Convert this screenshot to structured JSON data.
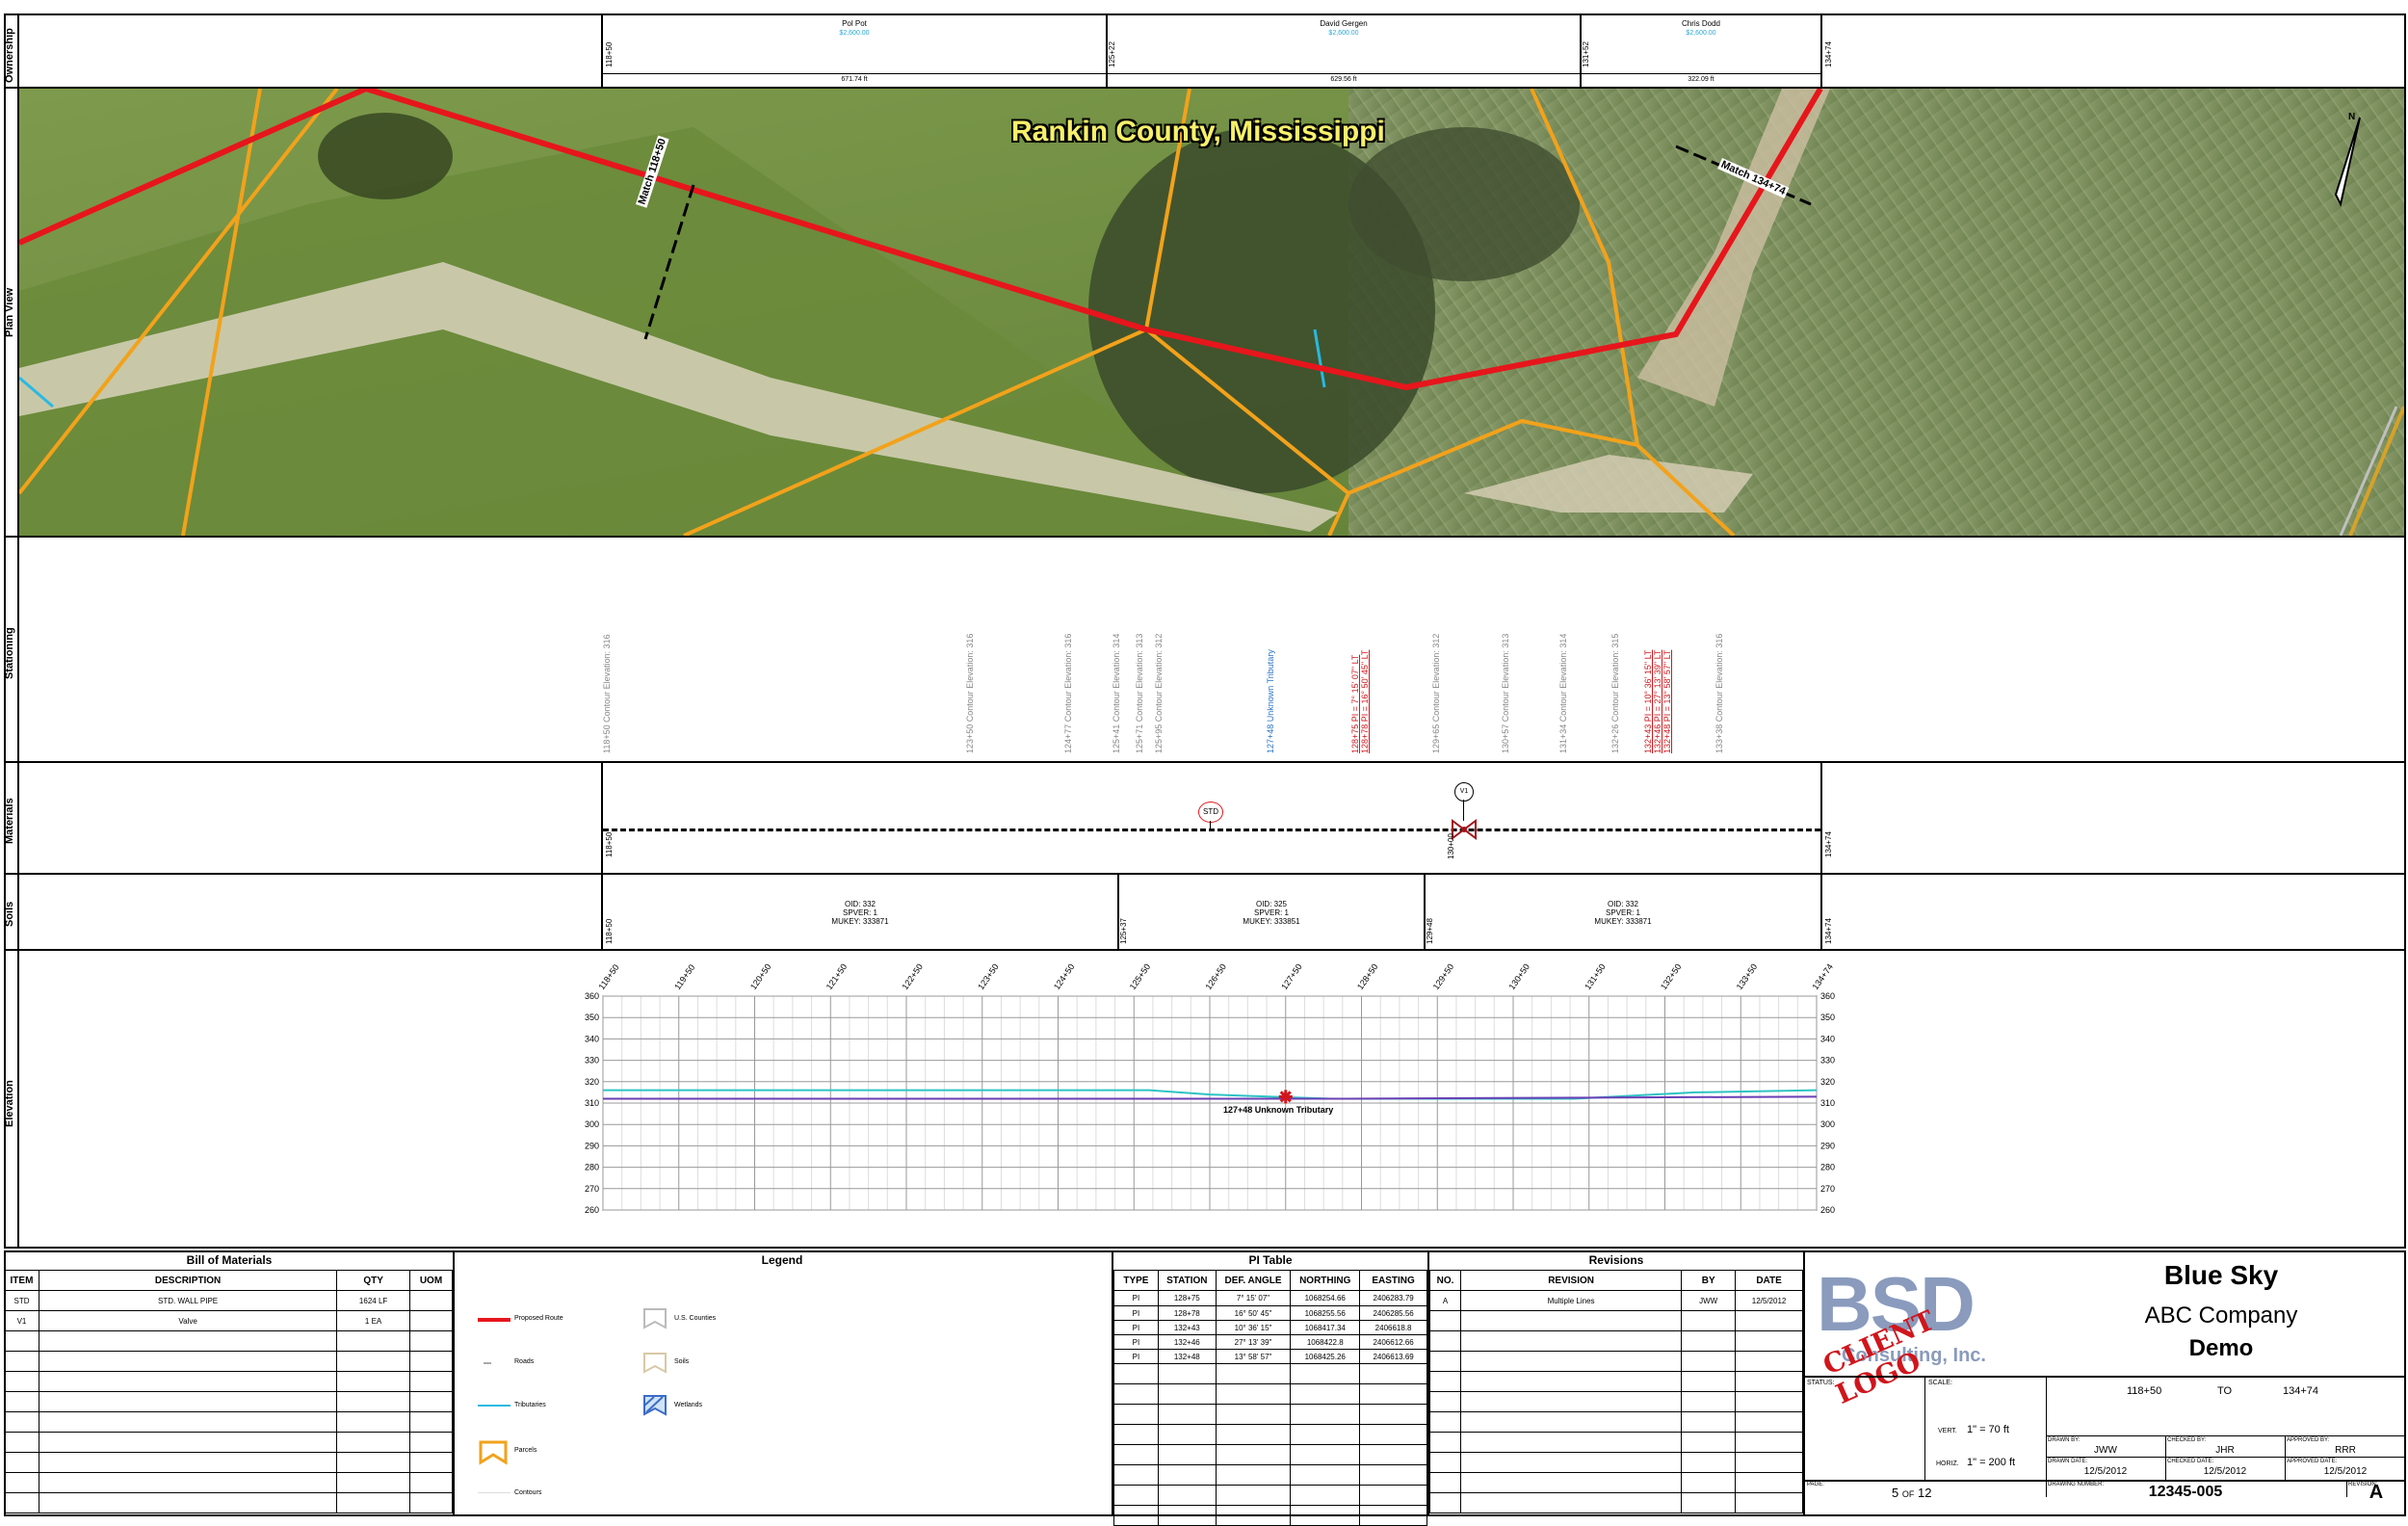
{
  "side_labels": [
    "Ownership",
    "Plan View",
    "Stationing",
    "Materials",
    "Soils",
    "Elevation"
  ],
  "ownership": {
    "owners": [
      {
        "name": "Pol Pot",
        "value": "$2,600.00",
        "length": "671.74 ft"
      },
      {
        "name": "David Gergen",
        "value": "$2,600.00",
        "length": "629.56 ft"
      },
      {
        "name": "Chris Dodd",
        "value": "$2,600.00",
        "length": "322.09 ft"
      }
    ],
    "stations": [
      "118+50",
      "125+22",
      "131+52",
      "134+74"
    ]
  },
  "plan": {
    "title": "Rankin County, Mississippi",
    "match_left": "Match 118+50",
    "match_right": "Match 134+74",
    "north": "N"
  },
  "stationing": {
    "gray_labels": [
      "118+50 Contour Elevation: 316",
      "123+50 Contour Elevation: 316",
      "124+77 Contour Elevation: 316",
      "125+41 Contour Elevation: 314",
      "125+71 Contour Elevation: 313",
      "125+95 Contour Elevation: 312",
      "129+65 Contour Elevation: 312",
      "130+57 Contour Elevation: 313",
      "131+34 Contour Elevation: 314",
      "132+26 Contour Elevation: 315",
      "133+38 Contour Elevation: 316"
    ],
    "blue_label": "127+48 Unknown Tributary",
    "red_labels_a": [
      "128+75 PI = 7° 15' 07\" LT",
      "128+78 PI = 16° 50' 45\" LT"
    ],
    "red_labels_b": [
      "132+43 PI = 10° 36' 15\" LT",
      "132+46 PI = 27° 13' 39\" LT",
      "132+48 PI = 13° 58' 57\" LT"
    ]
  },
  "materials": {
    "std": "STD",
    "v1": "V1",
    "station_mid": "130+00",
    "start": "118+50",
    "end": "134+74"
  },
  "soils": {
    "segments": [
      {
        "oid": "OID: 332",
        "spver": "SPVER: 1",
        "mukey": "MUKEY: 333871",
        "station": "118+50"
      },
      {
        "oid": "OID: 325",
        "spver": "SPVER: 1",
        "mukey": "MUKEY: 333851",
        "station": "125+37"
      },
      {
        "oid": "OID: 332",
        "spver": "SPVER: 1",
        "mukey": "MUKEY: 333871",
        "station": "129+48"
      }
    ],
    "end": "134+74"
  },
  "elevation": {
    "stations": [
      "118+50",
      "119+50",
      "120+50",
      "121+50",
      "122+50",
      "123+50",
      "124+50",
      "125+50",
      "126+50",
      "127+50",
      "128+50",
      "129+50",
      "130+50",
      "131+50",
      "132+50",
      "133+50",
      "134+74"
    ],
    "yticks": [
      360,
      350,
      340,
      330,
      320,
      310,
      300,
      290,
      280,
      270,
      260
    ],
    "marker_label": "127+48 Unknown Tributary"
  },
  "chart_data": {
    "type": "line",
    "x": [
      118.5,
      119.5,
      120.5,
      121.5,
      122.5,
      123.5,
      124.5,
      125.5,
      126.5,
      127.5,
      128.5,
      129.5,
      130.5,
      131.5,
      132.5,
      133.5,
      134.74
    ],
    "series": [],
    "ylim": [
      260,
      360
    ],
    "grid": true
  },
  "bom": {
    "title": "Bill of Materials",
    "headers": [
      "ITEM",
      "DESCRIPTION",
      "QTY",
      "UOM"
    ],
    "rows": [
      [
        "STD",
        "STD. WALL PIPE",
        "1624 LF",
        ""
      ],
      [
        "V1",
        "Valve",
        "1 EA",
        ""
      ]
    ]
  },
  "legend": {
    "title": "Legend",
    "items": [
      "Proposed Route",
      "Roads",
      "Tributaries",
      "Parcels",
      "Contours",
      "U.S. Counties",
      "Soils",
      "Wetlands"
    ]
  },
  "pi": {
    "title": "PI Table",
    "headers": [
      "TYPE",
      "STATION",
      "DEF. ANGLE",
      "NORTHING",
      "EASTING"
    ],
    "rows": [
      [
        "PI",
        "128+75",
        "7° 15' 07\"",
        "1068254.66",
        "2406283.79"
      ],
      [
        "PI",
        "128+78",
        "16° 50' 45\"",
        "1068255.56",
        "2406285.56"
      ],
      [
        "PI",
        "132+43",
        "10° 36' 15\"",
        "1068417.34",
        "2406618.8"
      ],
      [
        "PI",
        "132+46",
        "27° 13' 39\"",
        "1068422.8",
        "2406612.66"
      ],
      [
        "PI",
        "132+48",
        "13° 58' 57\"",
        "1068425.26",
        "2406613.69"
      ]
    ]
  },
  "revisions": {
    "title": "Revisions",
    "headers": [
      "NO.",
      "REVISION",
      "BY",
      "DATE"
    ],
    "rows": [
      [
        "A",
        "Multiple Lines",
        "JWW",
        "12/5/2012"
      ]
    ]
  },
  "title_block": {
    "logo_bsd": "BSD",
    "logo_consulting": "Consulting, Inc.",
    "logo_stamp": "CLIENT LOGO",
    "company1": "Blue Sky",
    "company2": "ABC Company",
    "company3": "Demo",
    "status_label": "STATUS:",
    "scale_label": "SCALE:",
    "from": "118+50",
    "to_word": "TO",
    "to": "134+74",
    "vert_label": "VERT.",
    "vert": "1\" = 70 ft",
    "horiz_label": "HORIZ.",
    "horiz": "1\" = 200 ft",
    "drawn_by_label": "DRAWN BY:",
    "drawn_by": "JWW",
    "checked_by_label": "CHECKED BY:",
    "checked_by": "JHR",
    "approved_by_label": "APPROVED BY:",
    "approved_by": "RRR",
    "drawn_date_label": "DRAWN DATE:",
    "drawn_date": "12/5/2012",
    "checked_date_label": "CHECKED DATE:",
    "checked_date": "12/5/2012",
    "approved_date_label": "APPROVED DATE:",
    "approved_date": "12/5/2012",
    "page_label": "PAGE:",
    "page": "5",
    "of": "OF",
    "total": "12",
    "drawing_number_label": "DRAWING NUMBER:",
    "drawing_number": "12345-005",
    "revision_label": "REVISION:",
    "revision": "A"
  }
}
